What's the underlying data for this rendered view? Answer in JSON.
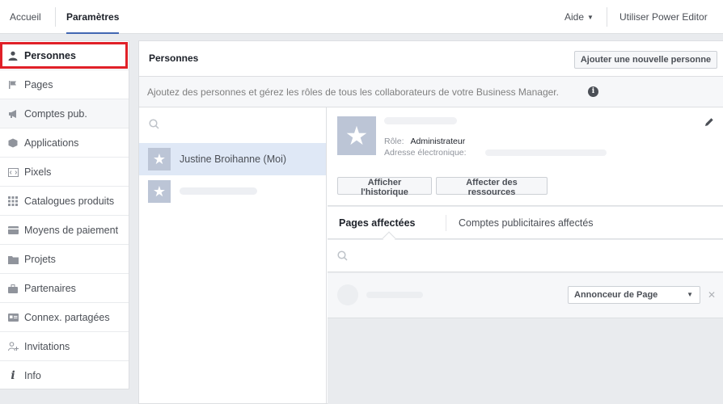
{
  "topbar": {
    "tab_home": "Accueil",
    "tab_settings": "Paramètres",
    "help": "Aide",
    "power_editor": "Utiliser Power Editor"
  },
  "sidebar": {
    "items": [
      {
        "label": "Personnes",
        "icon": "person-icon"
      },
      {
        "label": "Pages",
        "icon": "flag-icon"
      },
      {
        "label": "Comptes pub.",
        "icon": "megaphone-icon"
      },
      {
        "label": "Applications",
        "icon": "cube-icon"
      },
      {
        "label": "Pixels",
        "icon": "code-icon"
      },
      {
        "label": "Catalogues produits",
        "icon": "grid-icon"
      },
      {
        "label": "Moyens de paiement",
        "icon": "card-icon"
      },
      {
        "label": "Projets",
        "icon": "folder-icon"
      },
      {
        "label": "Partenaires",
        "icon": "briefcase-icon"
      },
      {
        "label": "Connex. partagées",
        "icon": "id-card-icon"
      },
      {
        "label": "Invitations",
        "icon": "add-person-icon"
      },
      {
        "label": "Info",
        "icon": "info-icon"
      }
    ]
  },
  "main": {
    "title": "Personnes",
    "add_person_label": "Ajouter une nouvelle personne",
    "description": "Ajoutez des personnes et gérez les rôles de tous les collaborateurs de votre Business Manager."
  },
  "people": [
    {
      "name": "Justine Broihanne (Moi)",
      "selected": true
    },
    {
      "name": "",
      "selected": false
    }
  ],
  "detail": {
    "role_label": "Rôle:",
    "role_value": "Administrateur",
    "email_label": "Adresse électronique:",
    "history_button": "Afficher l'historique",
    "assign_button": "Affecter des ressources",
    "tab_pages": "Pages affectées",
    "tab_accounts": "Comptes publicitaires affectés",
    "asset_role": "Annonceur de Page"
  },
  "colors": {
    "accent": "#4267b2",
    "highlight": "#e02028"
  }
}
